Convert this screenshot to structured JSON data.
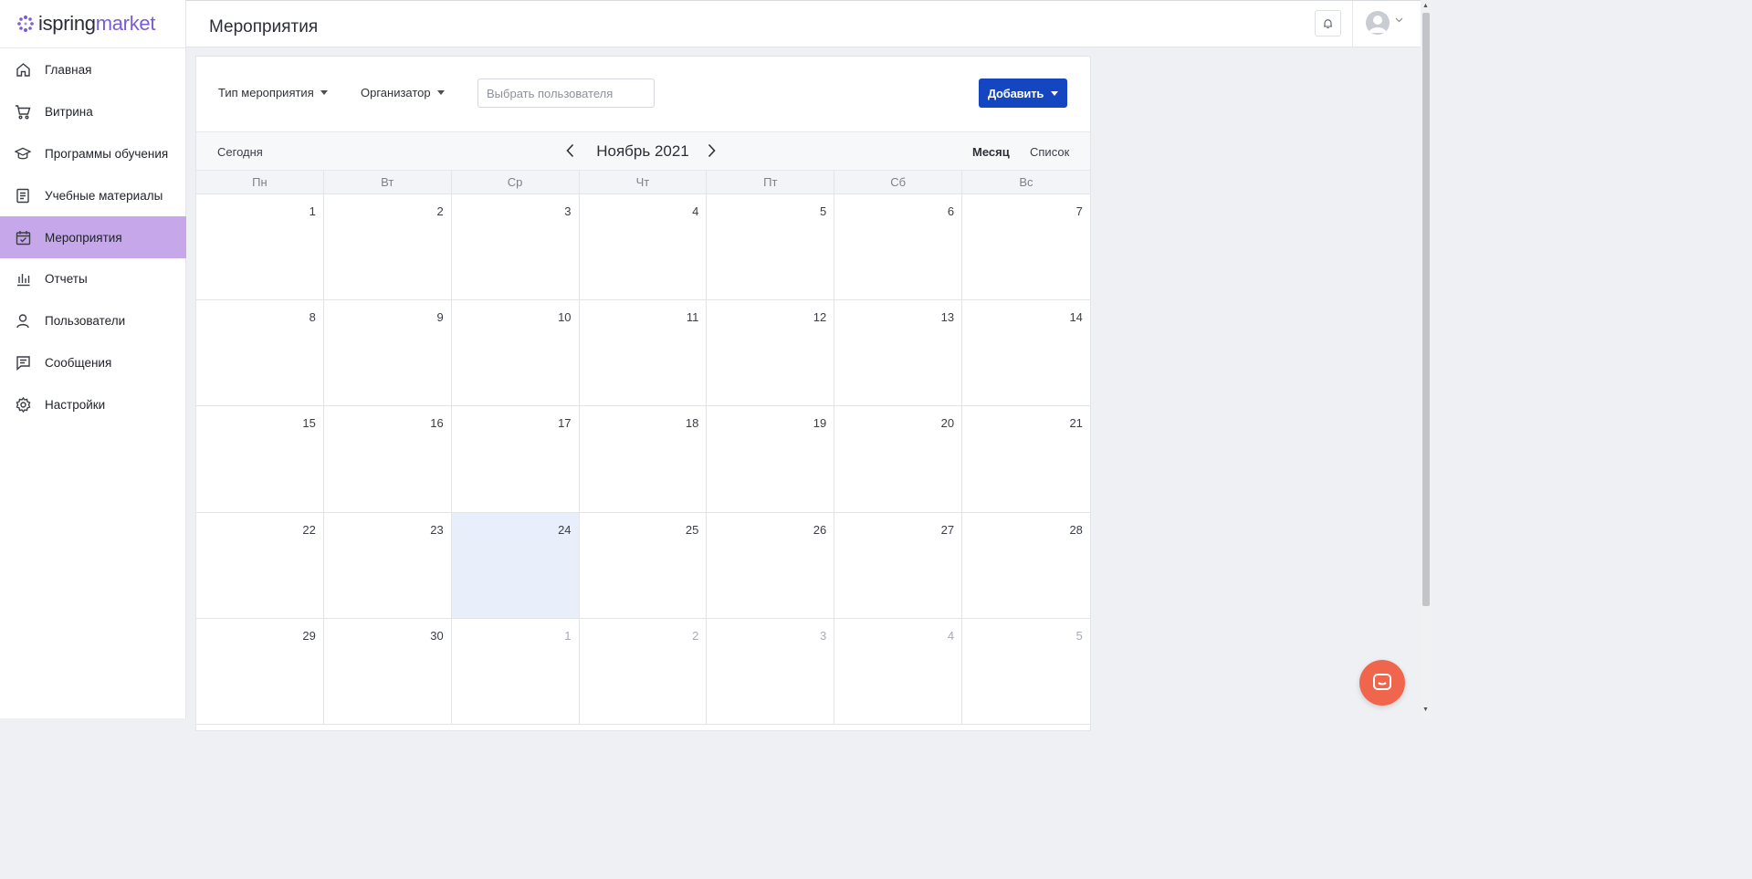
{
  "brand": {
    "part1": "ispring",
    "part2": "market",
    "accent": "#7a5cd6"
  },
  "sidebar": {
    "items": [
      {
        "label": "Главная",
        "icon": "home-icon"
      },
      {
        "label": "Витрина",
        "icon": "cart-icon"
      },
      {
        "label": "Программы обучения",
        "icon": "graduation-cap-icon"
      },
      {
        "label": "Учебные материалы",
        "icon": "document-icon"
      },
      {
        "label": "Мероприятия",
        "icon": "calendar-check-icon",
        "active": true
      },
      {
        "label": "Отчеты",
        "icon": "bar-chart-icon"
      },
      {
        "label": "Пользователи",
        "icon": "user-icon"
      },
      {
        "label": "Сообщения",
        "icon": "message-icon"
      },
      {
        "label": "Настройки",
        "icon": "gear-icon"
      }
    ],
    "active_color": "#c6a8ea"
  },
  "header": {
    "title": "Мероприятия"
  },
  "filters": {
    "event_type": "Тип мероприятия",
    "organizer": "Организатор",
    "user_placeholder": "Выбрать пользователя",
    "add_label": "Добавить",
    "add_color": "#1346c0"
  },
  "calendar": {
    "today_label": "Сегодня",
    "month_title": "Ноябрь 2021",
    "view_month": "Месяц",
    "view_list": "Список",
    "weekdays": [
      "Пн",
      "Вт",
      "Ср",
      "Чт",
      "Пт",
      "Сб",
      "Вс"
    ],
    "weeks": [
      [
        "1",
        "2",
        "3",
        "4",
        "5",
        "6",
        "7"
      ],
      [
        "8",
        "9",
        "10",
        "11",
        "12",
        "13",
        "14"
      ],
      [
        "15",
        "16",
        "17",
        "18",
        "19",
        "20",
        "21"
      ],
      [
        "22",
        "23",
        "24",
        "25",
        "26",
        "27",
        "28"
      ],
      [
        "29",
        "30",
        "1",
        "2",
        "3",
        "4",
        "5"
      ]
    ],
    "today_day": "24"
  }
}
